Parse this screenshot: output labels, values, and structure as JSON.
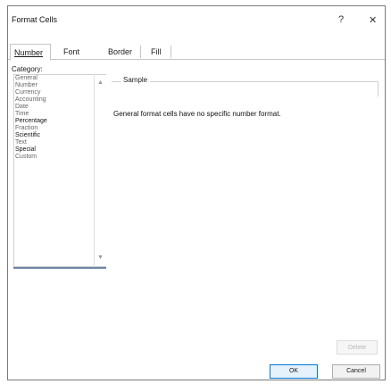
{
  "window": {
    "title": "Format Cells",
    "help_glyph": "?",
    "close_glyph": "✕"
  },
  "tabs": [
    {
      "label": "Number",
      "active": true
    },
    {
      "label": "Font",
      "active": false
    },
    {
      "label": "Border",
      "active": false
    },
    {
      "label": "Fill",
      "active": false
    }
  ],
  "category": {
    "label": "Category:",
    "items": [
      {
        "label": "General",
        "selected": false
      },
      {
        "label": "Number",
        "selected": false
      },
      {
        "label": "Currency",
        "selected": false
      },
      {
        "label": "Accounting",
        "selected": false
      },
      {
        "label": "Date",
        "selected": false
      },
      {
        "label": "Time",
        "selected": false
      },
      {
        "label": "Percentage",
        "selected": false
      },
      {
        "label": "Fraction",
        "selected": false
      },
      {
        "label": "Scientific",
        "selected": false
      },
      {
        "label": "Text",
        "selected": false
      },
      {
        "label": "Special",
        "selected": false
      },
      {
        "label": "Custom",
        "selected": false
      }
    ],
    "scroll_up_glyph": "▲",
    "scroll_down_glyph": "▼"
  },
  "sample": {
    "label": "Sample"
  },
  "description": "General format cells have no specific number format.",
  "buttons": {
    "delete": "Delete",
    "ok": "OK",
    "cancel": "Cancel"
  }
}
